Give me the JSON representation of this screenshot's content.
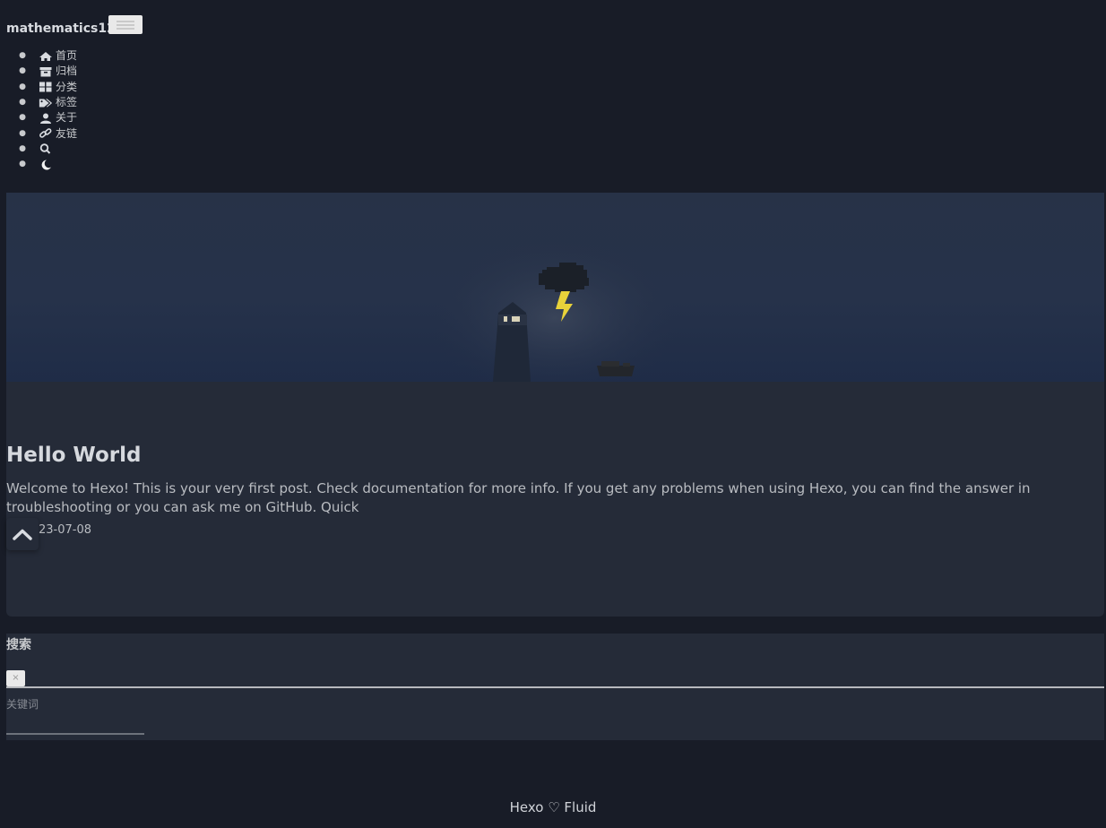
{
  "navbar": {
    "brand": "mathematics128",
    "items": [
      {
        "icon": "home-icon",
        "label": "首页"
      },
      {
        "icon": "archive-icon",
        "label": "归档"
      },
      {
        "icon": "category-icon",
        "label": "分类"
      },
      {
        "icon": "tags-icon",
        "label": "标签"
      },
      {
        "icon": "user-icon",
        "label": "关于"
      },
      {
        "icon": "link-icon",
        "label": "友链"
      },
      {
        "icon": "search-icon",
        "label": ""
      },
      {
        "icon": "moon-icon",
        "label": ""
      }
    ]
  },
  "post": {
    "title": "Hello World",
    "excerpt": "Welcome to Hexo! This is your very first post. Check documentation for more info. If you get any problems when using Hexo, you can find the answer in troubleshooting or you can ask me on GitHub. Quick",
    "date": "23-07-08"
  },
  "search": {
    "title": "搜索",
    "close_label": "×",
    "keyword_label": "关键词",
    "keyword_value": ""
  },
  "footer": {
    "text": "Hexo ♡ Fluid"
  },
  "colors": {
    "background": "#181c27",
    "card": "#252b38",
    "lightning": "#e8d23a"
  }
}
